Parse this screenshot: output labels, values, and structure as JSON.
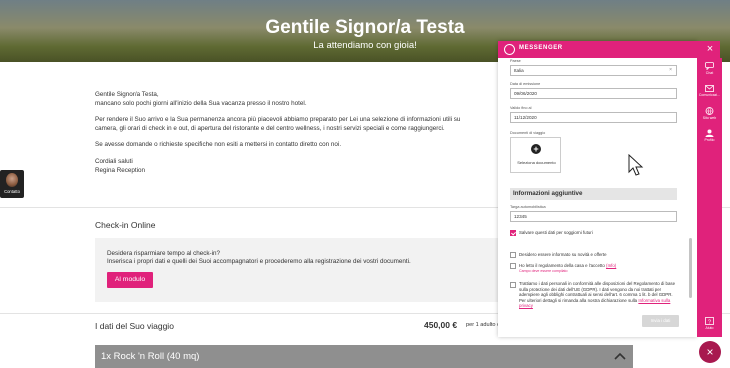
{
  "hero": {
    "title": "Gentile Signor/a Testa",
    "subtitle": "La attendiamo con gioia!"
  },
  "letter": {
    "greeting": "Gentile Signor/a Testa,",
    "line1": "mancano solo pochi giorni all'inizio della Sua vacanza presso il nostro hotel.",
    "line2": "Per rendere il Suo arrivo e la Sua permanenza ancora più piacevoli abbiamo preparato per Lei una selezione di informazioni utili su",
    "line3": "camera, gli orari di check in e out, di apertura del ristorante e del centro wellness, i nostri servizi speciali e come raggiungerci.",
    "line4": "Se avesse domande o richieste specifiche non esiti a mettersi in contatto diretto con noi.",
    "sign1": "Cordiali saluti",
    "sign2": "Regina Reception"
  },
  "avatar": {
    "name": "Contatto"
  },
  "checkin": {
    "title": "Check-in Online",
    "question": "Desidera risparmiare tempo al check-in?",
    "instruction": "Inserisca i propri dati e quelli dei Suoi accompagnatori e procederemo alla registrazione dei vostri documenti.",
    "button": "Al modulo"
  },
  "trip": {
    "title": "I dati del Suo viaggio",
    "price": "450,00 €",
    "per": "per 1 adulto d"
  },
  "room": {
    "label": "1x Rock 'n Roll (40 mq)"
  },
  "messenger": {
    "title": "MESSENGER",
    "close": "×",
    "fields": {
      "country_label": "Paese",
      "country_value": "Italia",
      "issue_label": "Data di emissione",
      "issue_value": "09/06/2020",
      "valid_label": "Valido fino al",
      "valid_value": "11/12/2020",
      "docs_label": "Documenti di viaggio",
      "upload_label": "Seleziona documento",
      "info_heading": "Informazioni aggiuntive",
      "plate_label": "Targa automobilistica",
      "plate_value": "12345"
    },
    "checks": {
      "save_label": "Salvare questi dati per soggiorni futuri",
      "newsletter_label": "Desidero essere informato su novità e offerte",
      "rules_label": "Ho letto il regolamento della casa e l'accetto",
      "rules_link": "(Info)",
      "required": "Campo deve essere compilato",
      "gdpr_label": "Trattiamo i dati personali in conformità alle disposizioni del Regolamento di base sulla protezione dei dati dell'UE (GDPR). I dati vengono da noi trattati per adempiere agli obblighi contrattuali ai sensi dell'art. 6 comma 1 lit. b del GDPR. Per ulteriori dettagli si rimanda alla nostra dichiarazione sulla",
      "gdpr_link": "Informativa sulla privacy",
      "save_checked": true
    },
    "send_button": "Invia i dati"
  },
  "rail": {
    "chat": "Chat",
    "comms": "Comunicazi...",
    "site": "Sito web",
    "profile": "Profilo",
    "help": "Aiuto"
  },
  "colors": {
    "accent": "#e0227b",
    "accent_dark": "#a8194f"
  }
}
